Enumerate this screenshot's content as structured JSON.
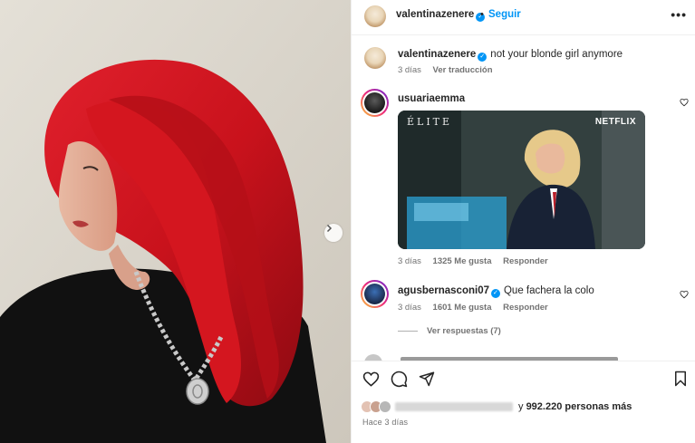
{
  "post_header": {
    "username": "valentinazenere",
    "separator": "•",
    "follow_label": "Seguir",
    "more_label": "•••"
  },
  "caption": {
    "username": "valentinazenere",
    "text": "not your blonde girl anymore",
    "time": "3 días",
    "translate_label": "Ver traducción"
  },
  "comments": [
    {
      "username": "usuariaemma",
      "gif": {
        "title": "ÉLITE",
        "brand": "NETFLIX"
      },
      "time": "3 días",
      "likes": "1325 Me gusta",
      "reply_label": "Responder"
    },
    {
      "username": "agusbernasconi07",
      "text": "Que fachera la colo",
      "time": "3 días",
      "likes": "1601 Me gusta",
      "reply_label": "Responder",
      "view_replies_label": "Ver respuestas (7)"
    }
  ],
  "likes_summary": {
    "prefix": "y",
    "count": "992.220",
    "suffix": "personas más"
  },
  "posted_ago": "Hace 3 días",
  "colors": {
    "accent": "#0095f6",
    "hair": "#c9121c",
    "text": "#262626",
    "muted": "#737373"
  },
  "icons": [
    "heart-icon",
    "comment-icon",
    "share-icon",
    "bookmark-icon",
    "chevron-right-icon",
    "verified-icon",
    "more-icon"
  ]
}
